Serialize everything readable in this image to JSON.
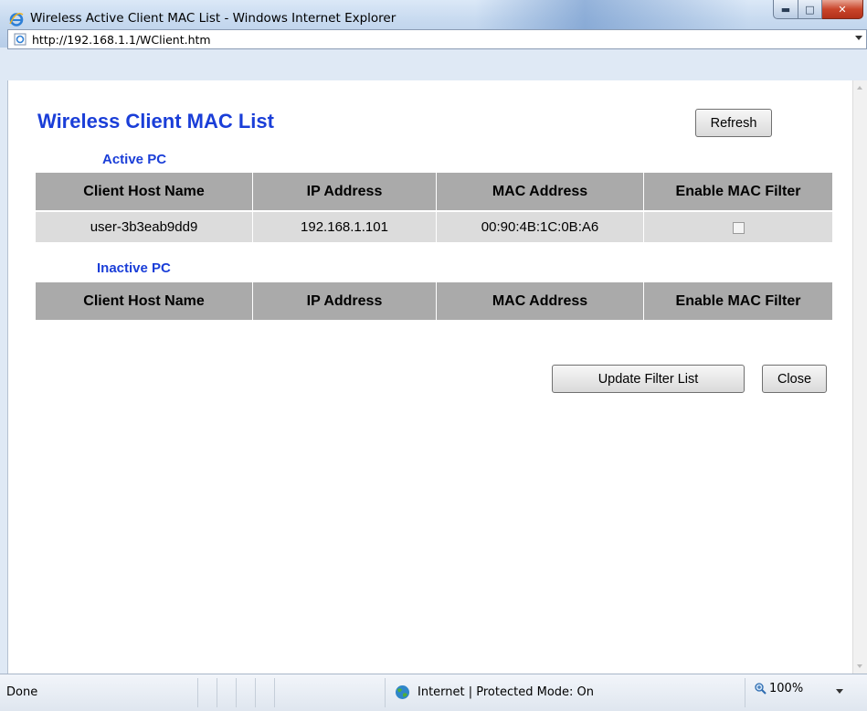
{
  "window": {
    "title": "Wireless Active Client MAC List - Windows Internet Explorer",
    "address": "http://192.168.1.1/WClient.htm"
  },
  "page": {
    "title": "Wireless Client MAC List",
    "refresh_label": "Refresh",
    "active_label": "Active PC",
    "inactive_label": "Inactive PC",
    "columns": [
      "Client Host Name",
      "IP Address",
      "MAC Address",
      "Enable MAC Filter"
    ],
    "active_rows": [
      {
        "host": "user-3b3eab9dd9",
        "ip": "192.168.1.101",
        "mac": "00:90:4B:1C:0B:A6",
        "filter_enabled": false
      }
    ],
    "update_label": "Update Filter List",
    "close_label": "Close"
  },
  "status": {
    "left": "Done",
    "zone": "Internet | Protected Mode: On",
    "zoom": "100%"
  },
  "colors": {
    "accent_blue": "#1a3ed8",
    "header_gray": "#aaaaaa",
    "row_gray": "#dcdcdc"
  }
}
